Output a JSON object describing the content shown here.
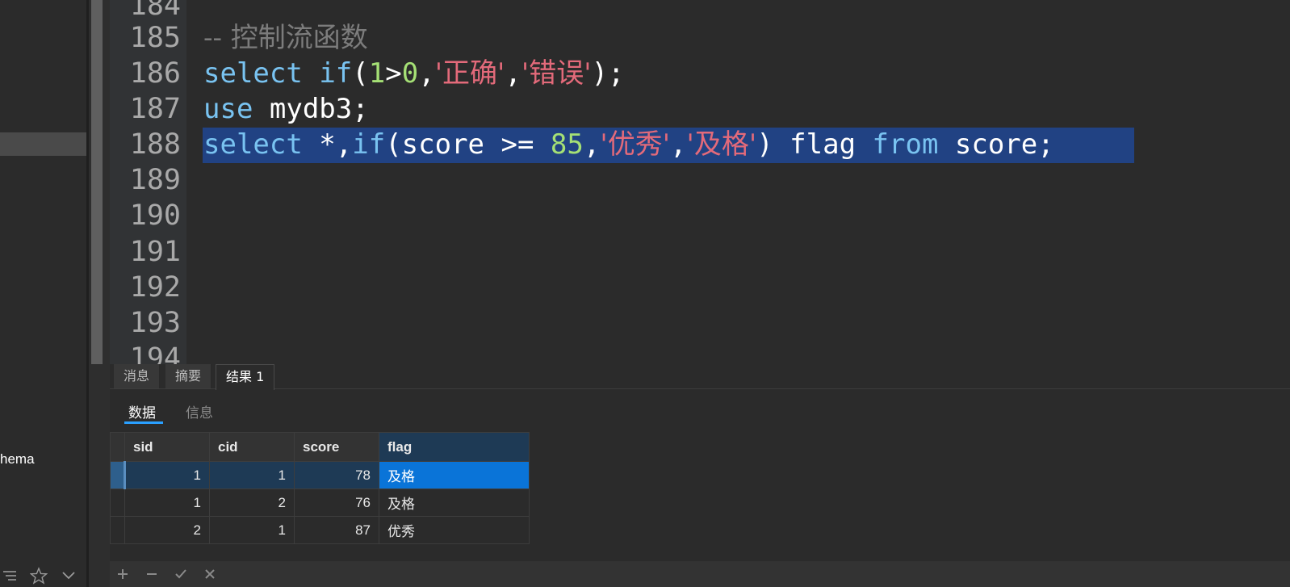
{
  "sidebar": {
    "item_schema": "hema"
  },
  "editor": {
    "line_numbers": [
      "184",
      "185",
      "186",
      "187",
      "188",
      "189",
      "190",
      "191",
      "192",
      "193",
      "194"
    ],
    "line185_comment": "-- 控制流函数",
    "line186": {
      "kw1": "select",
      "kw2": "if",
      "p1": "(",
      "n1": "1",
      "op": ">",
      "n2": "0",
      "c1": ",",
      "s1": "'正确'",
      "c2": ",",
      "s2": "'错误'",
      "end": ");"
    },
    "line187": {
      "kw": "use",
      "rest": " mydb3;"
    },
    "line188": {
      "kw1": "select",
      "t1": " *,",
      "kw2": "if",
      "t2": "(score >= ",
      "n1": "85",
      "c1": ",",
      "s1": "'优秀'",
      "c2": ",",
      "s2": "'及格'",
      "t3": ") flag ",
      "kw3": "from",
      "t4": " score;"
    }
  },
  "results": {
    "tabs": [
      "消息",
      "摘要",
      "结果 1"
    ],
    "subtabs": [
      "数据",
      "信息"
    ],
    "columns": [
      "sid",
      "cid",
      "score",
      "flag"
    ],
    "rows": [
      [
        "1",
        "1",
        "78",
        "及格"
      ],
      [
        "1",
        "2",
        "76",
        "及格"
      ],
      [
        "2",
        "1",
        "87",
        "优秀"
      ]
    ]
  },
  "colors": {
    "keyword": "#79c3f1",
    "number": "#a5e075",
    "string": "#e36a7a",
    "selection": "#214283",
    "accent": "#0a74d8"
  }
}
